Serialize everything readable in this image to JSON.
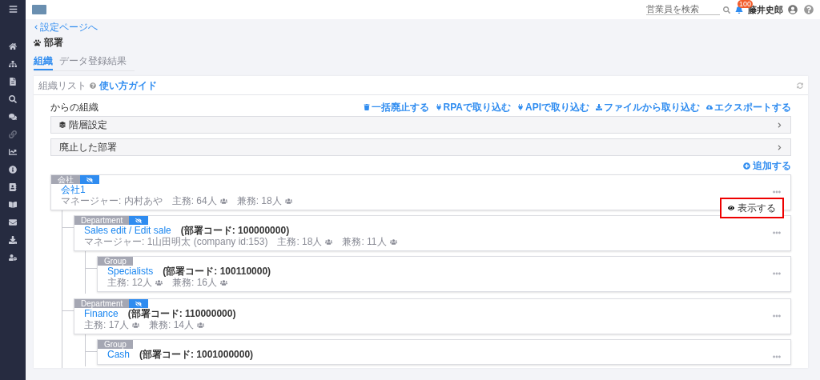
{
  "header": {
    "search": {
      "placeholder": "営業員を検索"
    },
    "notification_count": "100",
    "user_name": "藤井史郎"
  },
  "breadcrumb": "設定ページへ",
  "page_title": "部署",
  "tabs": [
    {
      "label": "組織",
      "selected": true
    },
    {
      "label": "データ登録結果",
      "selected": false
    }
  ],
  "card": {
    "title": "組織リスト",
    "guide_link": "使い方ガイド",
    "section_title": "からの組織",
    "actions": [
      {
        "kind": "delete",
        "label": "一括廃止する"
      },
      {
        "kind": "rpa",
        "label": "RPAで取り込む"
      },
      {
        "kind": "api",
        "label": "APIで取り込む"
      },
      {
        "kind": "import",
        "label": "ファイルから取り込む"
      },
      {
        "kind": "export",
        "label": "エクスポートする"
      }
    ],
    "panels": [
      {
        "label": "階層設定",
        "kind": "hierarchy",
        "expanded": false
      },
      {
        "label": "廃止した部署",
        "kind": "plain",
        "expanded": false
      }
    ],
    "add_button": "追加する",
    "tree": [
      {
        "type_label": "会社",
        "hidden": true,
        "name": "会社1",
        "meta": [
          "マネージャー: 内村あや"
        ],
        "stats": [
          "主務: 64人",
          "兼務: 18人"
        ],
        "popup_menu": {
          "label": "表示する",
          "highlighted": true
        },
        "children": [
          {
            "type_label": "Department",
            "hidden": true,
            "name": "Sales edit / Edit sale",
            "code": "(部署コード: 100000000)",
            "meta": [
              "マネージャー: 1山田明太 (company id:153)"
            ],
            "stats": [
              "主務: 18人",
              "兼務: 11人"
            ],
            "children": [
              {
                "type_label": "Group",
                "hidden": false,
                "name": "Specialists",
                "code": "(部署コード: 100110000)",
                "stats": [
                  "主務: 12人",
                  "兼務: 16人"
                ]
              }
            ]
          },
          {
            "type_label": "Department",
            "hidden": true,
            "name": "Finance",
            "code": "(部署コード: 110000000)",
            "stats": [
              "主務: 17人",
              "兼務: 14人"
            ],
            "children": [
              {
                "type_label": "Group",
                "hidden": false,
                "name": "Cash",
                "code": "(部署コード: 1001000000)"
              }
            ]
          }
        ]
      }
    ]
  }
}
